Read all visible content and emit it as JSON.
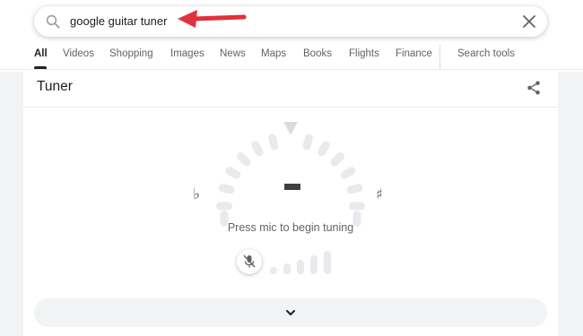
{
  "search": {
    "query": "google guitar tuner"
  },
  "tabs": [
    {
      "label": "All",
      "active": true
    },
    {
      "label": "Videos"
    },
    {
      "label": "Shopping"
    },
    {
      "label": "Images"
    },
    {
      "label": "News"
    },
    {
      "label": "Maps"
    },
    {
      "label": "Books"
    },
    {
      "label": "Flights"
    },
    {
      "label": "Finance"
    }
  ],
  "search_tools_label": "Search tools",
  "tuner": {
    "title": "Tuner",
    "flat_symbol": "♭",
    "sharp_symbol": "♯",
    "status": "Press mic to begin tuning"
  },
  "icons": {
    "search": "search-icon",
    "clear": "close-icon",
    "share": "share-icon",
    "mic": "mic-off-icon",
    "expand": "chevron-down-icon",
    "annotation": "red-arrow-icon"
  },
  "colors": {
    "annotation_arrow": "#e0323c",
    "dial_segments": "#e8eaed",
    "indicator": "#dadce0",
    "note_dash": "#3c4043"
  }
}
